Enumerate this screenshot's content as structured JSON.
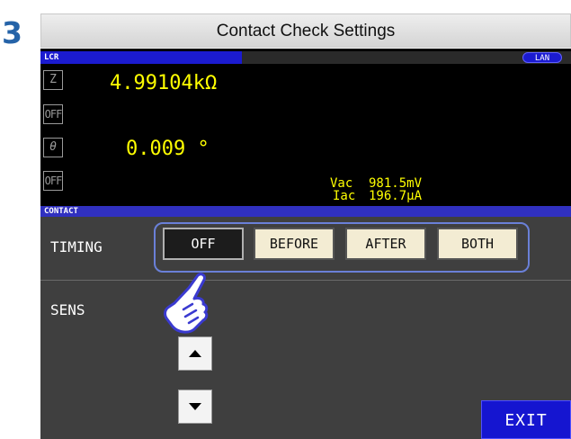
{
  "step_number": "3",
  "window_title": "Contact Check Settings",
  "header": {
    "mode_label": "LCR",
    "lan_label": "LAN"
  },
  "params": [
    {
      "param": "Z",
      "flag": "OFF",
      "value": "4.99104kΩ"
    },
    {
      "param": "θ",
      "flag": "OFF",
      "value": "0.009 °"
    }
  ],
  "monitor": {
    "vac_label": "Vac",
    "vac_value": "981.5mV",
    "iac_label": "Iac",
    "iac_value": "196.7μA"
  },
  "contact": {
    "section_label": "CONTACT",
    "timing_label": "TIMING",
    "timing_options": [
      "OFF",
      "BEFORE",
      "AFTER",
      "BOTH"
    ],
    "timing_selected": "OFF",
    "sens_label": "SENS"
  },
  "exit_label": "EXIT",
  "icons": [
    "up-arrow-icon",
    "down-arrow-icon",
    "pointing-hand-icon"
  ],
  "colors": {
    "accent_blue": "#1b1bd0",
    "measure_yellow": "#ffff00",
    "panel_gray": "#3f3f3f",
    "option_cream": "#f3ecd3"
  }
}
